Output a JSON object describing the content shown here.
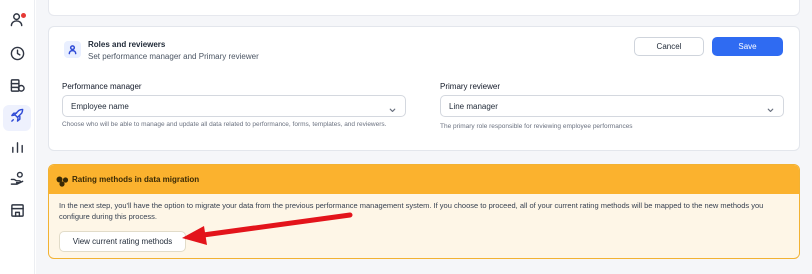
{
  "sidebar": {
    "items": [
      {
        "icon": "user-notification-icon",
        "active": false
      },
      {
        "icon": "clock-icon",
        "active": false
      },
      {
        "icon": "coins-icon",
        "active": false
      },
      {
        "icon": "rocket-icon",
        "active": true
      },
      {
        "icon": "bar-chart-icon",
        "active": false
      },
      {
        "icon": "hand-coin-icon",
        "active": false
      },
      {
        "icon": "building-icon",
        "active": false
      }
    ]
  },
  "roles": {
    "title": "Roles and reviewers",
    "subtitle": "Set performance manager and Primary reviewer",
    "cancel_label": "Cancel",
    "save_label": "Save",
    "performance_manager": {
      "label": "Performance manager",
      "value": "Employee name",
      "help": "Choose who will be able to manage and update all data related to performance, forms, templates, and reviewers."
    },
    "primary_reviewer": {
      "label": "Primary reviewer",
      "value": "Line manager",
      "help": "The primary role responsible for reviewing employee performances"
    }
  },
  "rating": {
    "title": "Rating methods in data migration",
    "body": "In the next step, you'll have the option to migrate your data from the previous performance management system. If you choose to proceed, all of your current rating methods will be mapped to the new methods you configure during this process.",
    "button_label": "View current rating methods"
  },
  "colors": {
    "accent": "#2f6bf2",
    "warning_header": "#fbb22e",
    "warning_bg": "#fef6e7",
    "annotation_arrow": "#e3141b",
    "notification_dot": "#e53935"
  }
}
